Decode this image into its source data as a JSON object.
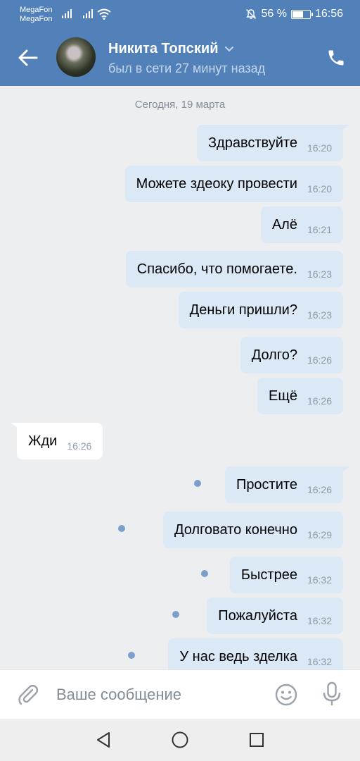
{
  "status_bar": {
    "carrier_1": "MegaFon",
    "carrier_2": "MegaFon",
    "battery_percent": "56 %",
    "battery_level": 0.56,
    "time": "16:56",
    "icons": [
      "signal-icon",
      "signal-icon",
      "wifi-icon",
      "mute-icon",
      "battery-icon"
    ]
  },
  "header": {
    "contact_name": "Никита Топский",
    "last_seen": "был в сети 27 минут назад",
    "icons": [
      "back-arrow-icon",
      "avatar",
      "chevron-down-icon",
      "phone-icon"
    ]
  },
  "chat": {
    "date_separator": "Сегодня, 19 марта",
    "messages": [
      {
        "text": "Здравствуйте",
        "time": "16:20",
        "direction": "out",
        "unread": false
      },
      {
        "text": "Можете здеоку провести",
        "time": "16:20",
        "direction": "out",
        "unread": false
      },
      {
        "text": "Алё",
        "time": "16:21",
        "direction": "out",
        "unread": false
      },
      {
        "text": "Спасибо, что помогаете.",
        "time": "16:23",
        "direction": "out",
        "unread": false
      },
      {
        "text": "Деньги пришли?",
        "time": "16:23",
        "direction": "out",
        "unread": false
      },
      {
        "text": "Долго?",
        "time": "16:26",
        "direction": "out",
        "unread": false
      },
      {
        "text": "Ещё",
        "time": "16:26",
        "direction": "out",
        "unread": false
      },
      {
        "text": "Жди",
        "time": "16:26",
        "direction": "in",
        "unread": false
      },
      {
        "text": "Простите",
        "time": "16:26",
        "direction": "out",
        "unread": true
      },
      {
        "text": "Долговато конечно",
        "time": "16:29",
        "direction": "out",
        "unread": true
      },
      {
        "text": "Быстрее",
        "time": "16:32",
        "direction": "out",
        "unread": true
      },
      {
        "text": "Пожалуйста",
        "time": "16:32",
        "direction": "out",
        "unread": true
      },
      {
        "text": "У нас ведь зделка",
        "time": "16:32",
        "direction": "out",
        "unread": true
      }
    ]
  },
  "composer": {
    "placeholder": "Ваше сообщение",
    "value": "",
    "icons": [
      "attach-icon",
      "emoji-icon",
      "microphone-icon"
    ]
  },
  "system_nav": {
    "icons": [
      "nav-back-icon",
      "nav-home-icon",
      "nav-recents-icon"
    ]
  },
  "colors": {
    "header_blue": "#5181b8",
    "chat_background": "#edeef0",
    "outgoing_bubble": "#dbe8f6",
    "incoming_bubble": "#ffffff",
    "unread_dot": "#7c9fcb",
    "muted_text": "#818c99"
  }
}
